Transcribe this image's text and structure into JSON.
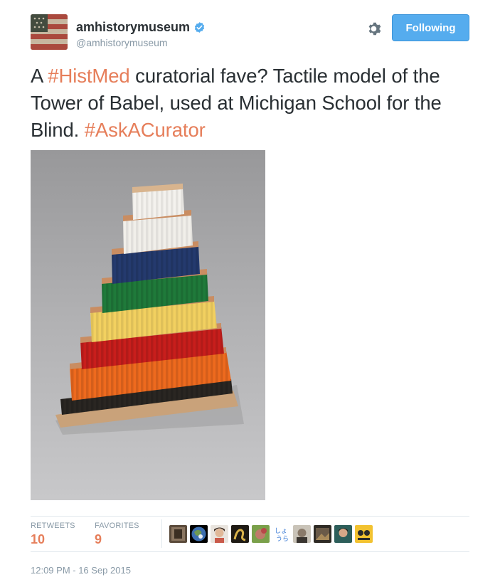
{
  "author": {
    "name": "amhistorymuseum",
    "handle": "@amhistorymuseum",
    "verified": true
  },
  "actions": {
    "follow_label": "Following",
    "settings_icon": "gear-icon"
  },
  "tweet": {
    "segments": [
      {
        "text": "A ",
        "type": "text"
      },
      {
        "text": "#HistMed",
        "type": "hashtag"
      },
      {
        "text": " curatorial fave? Tactile model of the Tower of Babel, used at Michigan School for the Blind. ",
        "type": "text"
      },
      {
        "text": "#AskACurator",
        "type": "hashtag"
      }
    ]
  },
  "stats": {
    "retweets_label": "RETWEETS",
    "retweets_value": "10",
    "favorites_label": "FAVORITES",
    "favorites_value": "9"
  },
  "timestamp": "12:09 PM - 16 Sep 2015",
  "colors": {
    "hashtag": "#e67e5a",
    "follow_button": "#55acee",
    "muted_text": "#8899a6"
  }
}
